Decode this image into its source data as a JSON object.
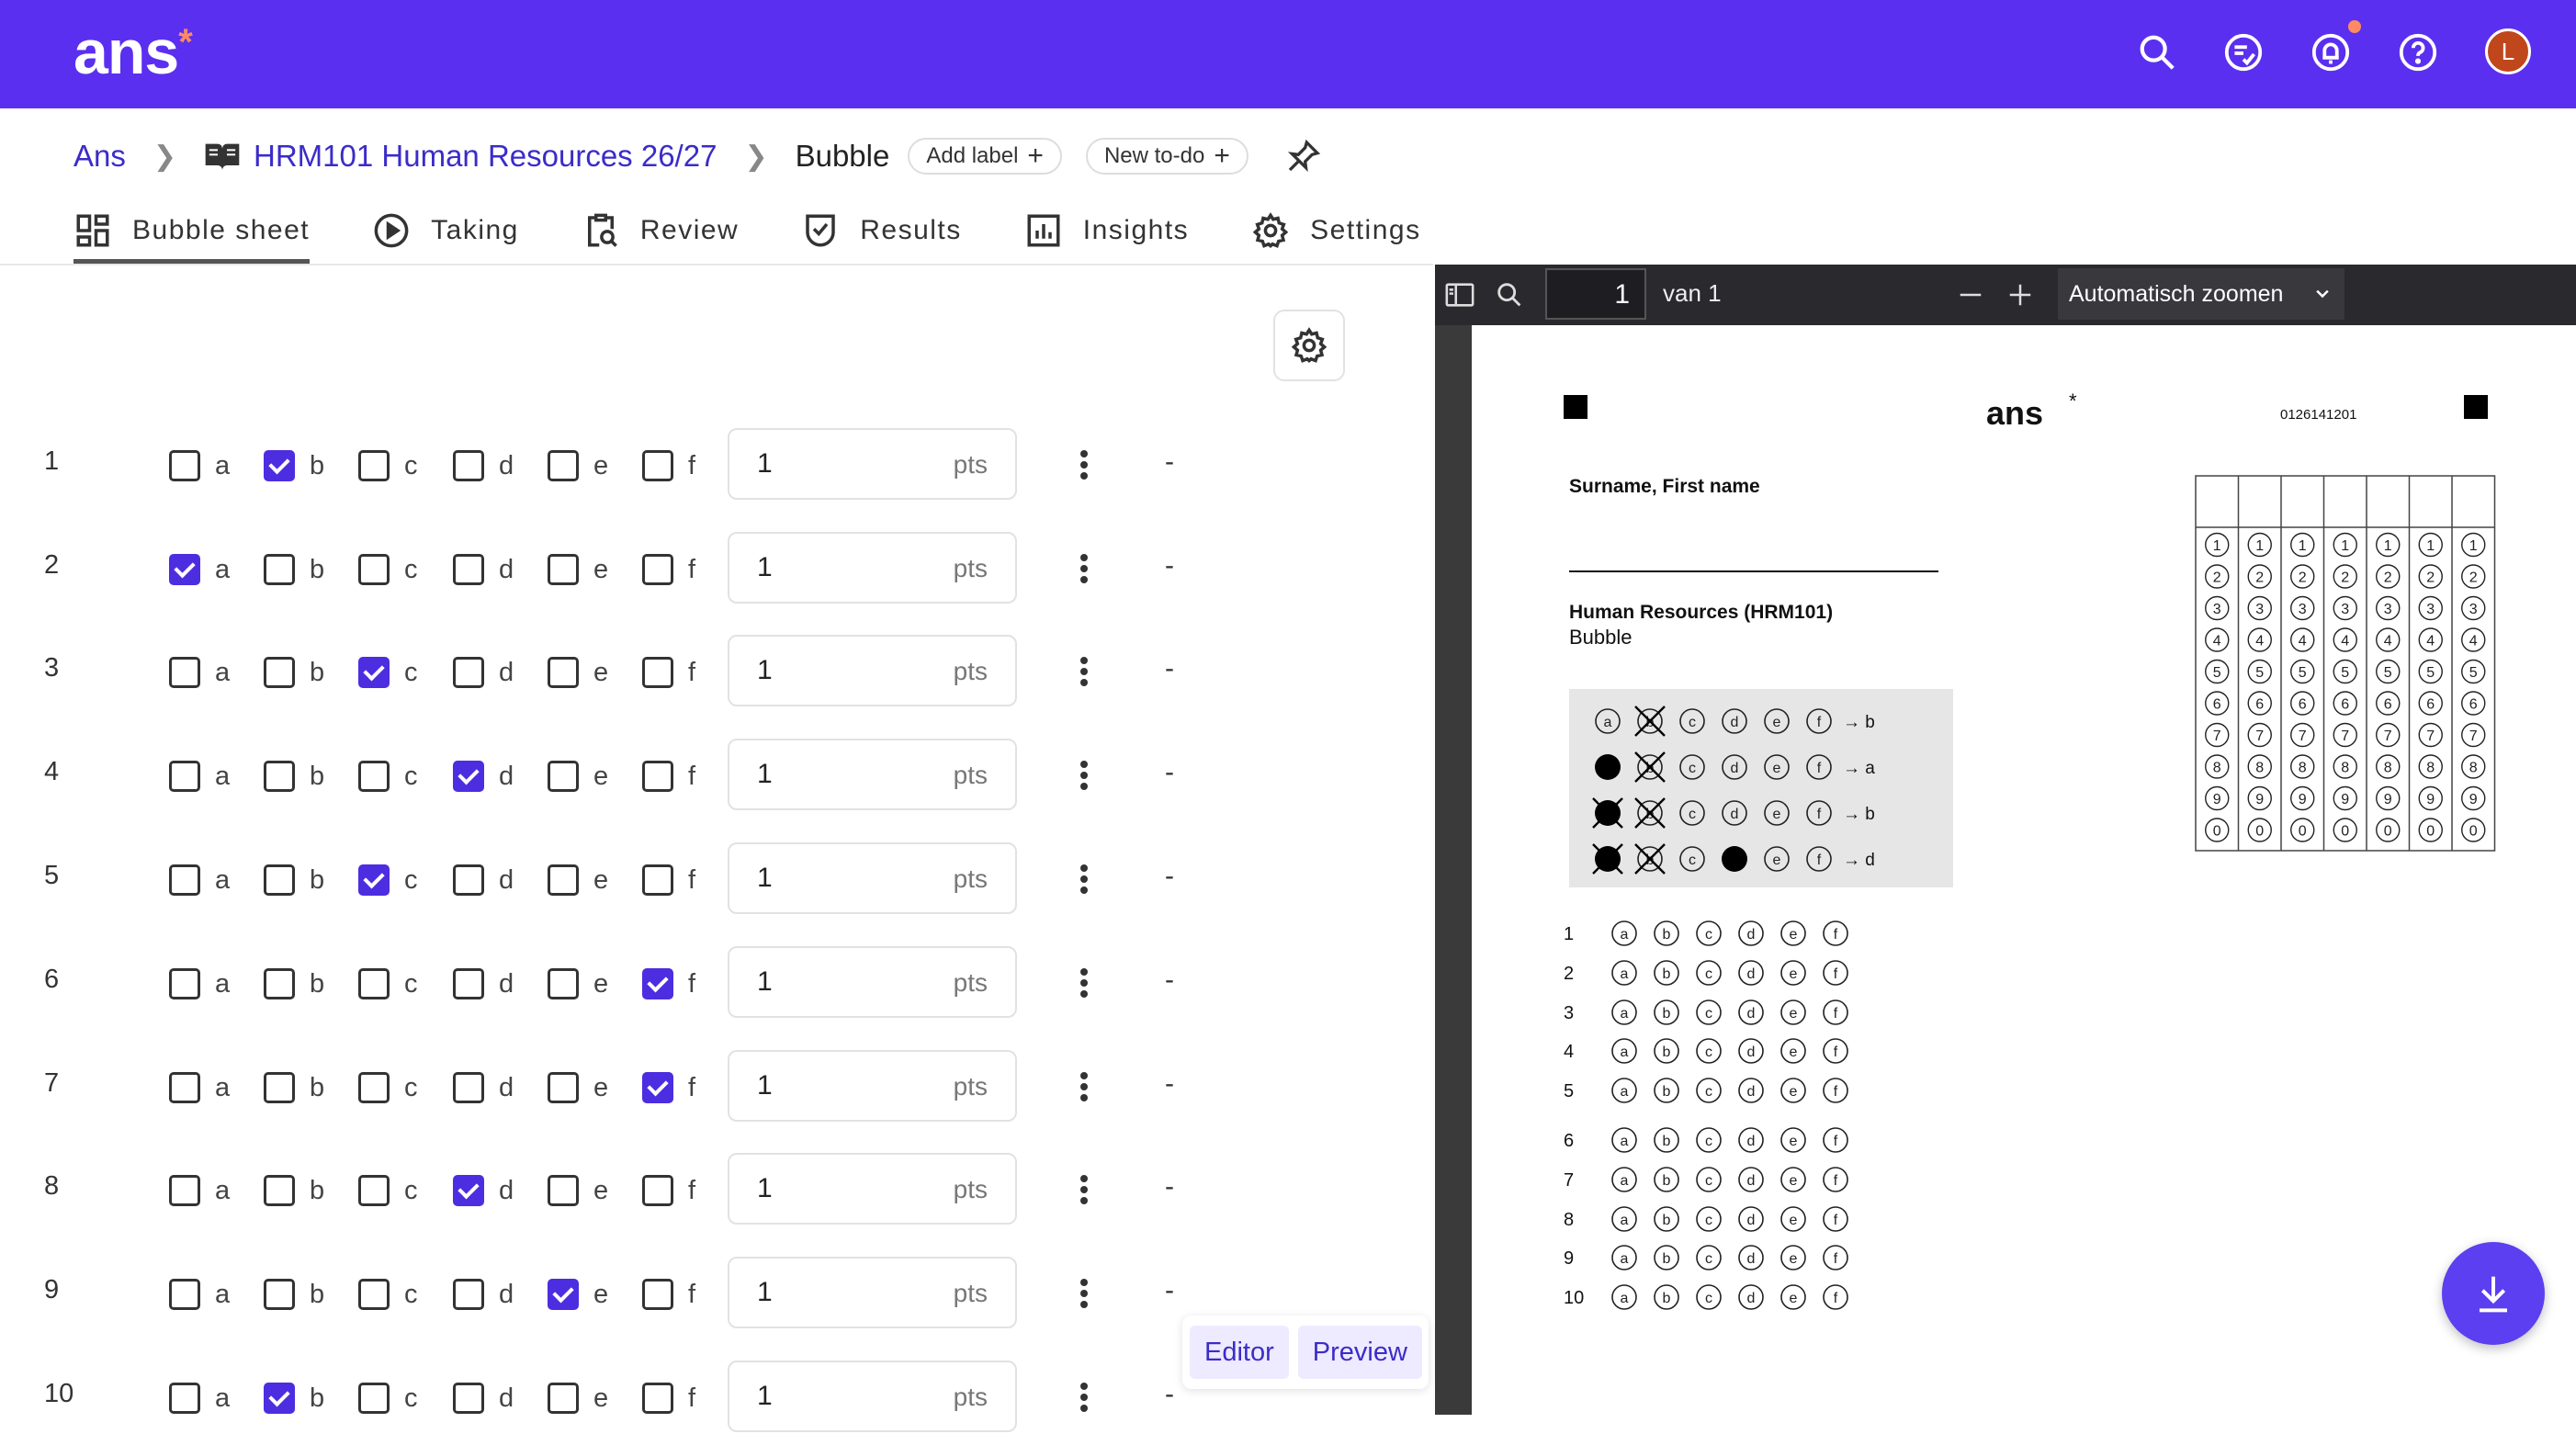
{
  "header": {
    "logo": "ans",
    "logo_star": "*",
    "avatar_initial": "L",
    "icons": [
      "search-icon",
      "tasks-icon",
      "bell-icon",
      "help-icon"
    ]
  },
  "breadcrumb": {
    "root": "Ans",
    "course": "HRM101 Human Resources 26/27",
    "current": "Bubble",
    "add_label": "Add label",
    "new_todo": "New to-do"
  },
  "tabs": [
    {
      "label": "Bubble sheet",
      "icon": "grid-icon",
      "active": true
    },
    {
      "label": "Taking",
      "icon": "play-icon"
    },
    {
      "label": "Review",
      "icon": "clipboard-search-icon"
    },
    {
      "label": "Results",
      "icon": "shield-check-icon"
    },
    {
      "label": "Insights",
      "icon": "bar-chart-icon"
    },
    {
      "label": "Settings",
      "icon": "gear-icon"
    }
  ],
  "questions": [
    {
      "number": "1",
      "checked": "b",
      "points": "1"
    },
    {
      "number": "2",
      "checked": "a",
      "points": "1"
    },
    {
      "number": "3",
      "checked": "c",
      "points": "1"
    },
    {
      "number": "4",
      "checked": "d",
      "points": "1"
    },
    {
      "number": "5",
      "checked": "c",
      "points": "1"
    },
    {
      "number": "6",
      "checked": "f",
      "points": "1"
    },
    {
      "number": "7",
      "checked": "f",
      "points": "1"
    },
    {
      "number": "8",
      "checked": "d",
      "points": "1"
    },
    {
      "number": "9",
      "checked": "e",
      "points": "1"
    },
    {
      "number": "10",
      "checked": "b",
      "points": "1"
    }
  ],
  "options": [
    "a",
    "b",
    "c",
    "d",
    "e",
    "f"
  ],
  "pts_unit": "pts",
  "score_placeholder": "-",
  "editor_toggle": {
    "editor": "Editor",
    "preview": "Preview"
  },
  "pdf_viewer": {
    "page": "1",
    "page_of": "van 1",
    "zoom": "Automatisch zoomen"
  },
  "sheet": {
    "logo": "ans",
    "logo_star": "*",
    "code": "0126141201",
    "name_label": "Surname, First name",
    "course": "Human Resources (HRM101)",
    "assignment": "Bubble",
    "examples": [
      "→ b",
      "→ a",
      "→ b",
      "→ d"
    ],
    "id_digits": [
      "1",
      "2",
      "3",
      "4",
      "5",
      "6",
      "7",
      "8",
      "9",
      "0"
    ],
    "question_numbers": [
      "1",
      "2",
      "3",
      "4",
      "5",
      "6",
      "7",
      "8",
      "9",
      "10"
    ]
  }
}
